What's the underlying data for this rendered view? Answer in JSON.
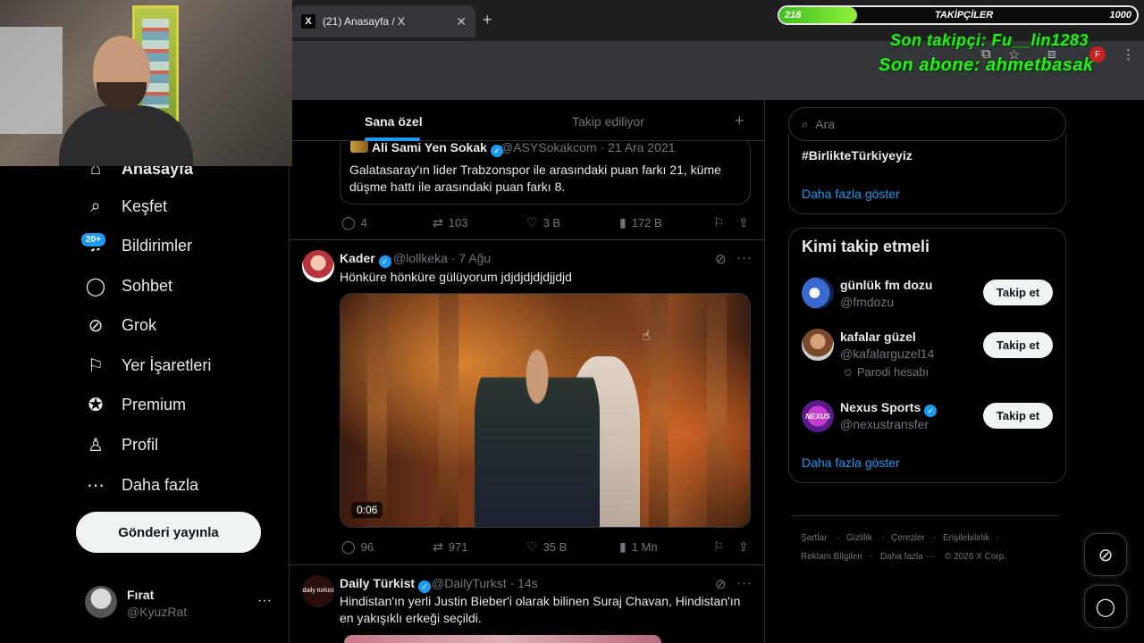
{
  "browser": {
    "tab_title": "(21) Anasayfa / X",
    "tab_logo": "X",
    "tab_close": "✕",
    "new_tab": "+"
  },
  "overlay": {
    "followers_label": "TAKİPÇİLER",
    "followers_current": "218",
    "followers_goal": "1000",
    "followers_progress": 0.218,
    "last_follower": "Son takipçi: Fu__lin1283",
    "last_subscriber": "Son abone: ahmetbasak"
  },
  "sidebar": {
    "items": [
      {
        "label": "Anasayfa",
        "icon": "home-icon"
      },
      {
        "label": "Keşfet",
        "icon": "search-icon"
      },
      {
        "label": "Bildirimler",
        "icon": "bell-icon"
      },
      {
        "label": "Sohbet",
        "icon": "chat-icon"
      },
      {
        "label": "Grok",
        "icon": "grok-icon"
      },
      {
        "label": "Yer İşaretleri",
        "icon": "bookmark-icon"
      },
      {
        "label": "Premium",
        "icon": "premium-icon"
      },
      {
        "label": "Profil",
        "icon": "profile-icon"
      },
      {
        "label": "Daha fazla",
        "icon": "more-icon"
      }
    ],
    "notif_badge": "20+",
    "post_button": "Gönderi yayınla",
    "user": {
      "name": "Fırat",
      "handle": "@KyuzRat",
      "more": "···"
    }
  },
  "feed": {
    "tabs": [
      "Sana özel",
      "Takip ediliyor"
    ],
    "add_tab": "+",
    "quote": {
      "name": "Ali Sami Yen Sokak",
      "meta": "@ASYSokakcom · 21 Ara 2021",
      "text": "Galatasaray'ın lider Trabzonspor ile arasındaki puan farkı 21, küme düşme hattı ile arasındaki puan farkı 8."
    },
    "actions1": {
      "replies": "4",
      "reposts": "103",
      "likes": "3 B",
      "views": "172 B"
    },
    "tweet2": {
      "name": "Kader",
      "meta": "@lollkeka · 7 Ağu",
      "text": "Hönküre hönküre gülüyorum jdjdjdjdjdjjdjd",
      "video_duration": "0:06"
    },
    "actions2": {
      "replies": "96",
      "reposts": "971",
      "likes": "35 B",
      "views": "1 Mn"
    },
    "tweet3": {
      "name": "Daily Türkist",
      "meta": "@DailyTurkst · 14s",
      "text": "Hindistan'ın yerli Justin Bieber'i olarak bilinen Suraj Chavan, Hindistan'ın en yakışıklı erkeği seçildi.",
      "avatar_text": "daily türkist"
    }
  },
  "right": {
    "search_placeholder": "Ara",
    "trend": "#BirlikteTürkiyeyiz",
    "show_more": "Daha fazla göster",
    "who_to_follow_title": "Kimi takip etmeli",
    "suggestions": [
      {
        "name": "günlük fm dozu",
        "handle": "@fmdozu",
        "button": "Takip et"
      },
      {
        "name": "kafalar güzel",
        "handle": "@kafalarguzel14",
        "button": "Takip et",
        "note": "Parodi hesabı"
      },
      {
        "name": "Nexus Sports",
        "handle": "@nexustransfer",
        "button": "Takip et",
        "avatar_text": "NEXUS"
      }
    ],
    "show_more_2": "Daha fazla göster",
    "footer_row1": [
      "Şartlar",
      "Gizlilik",
      "Çerezler",
      "Erişilebilirlik"
    ],
    "footer_row2": [
      "Reklam Bilgileri",
      "Daha fazla ···",
      "© 2026 X Corp."
    ]
  },
  "colors": {
    "accent": "#1d9bf0",
    "background": "#000000",
    "overlay_green": "#2eea22"
  }
}
